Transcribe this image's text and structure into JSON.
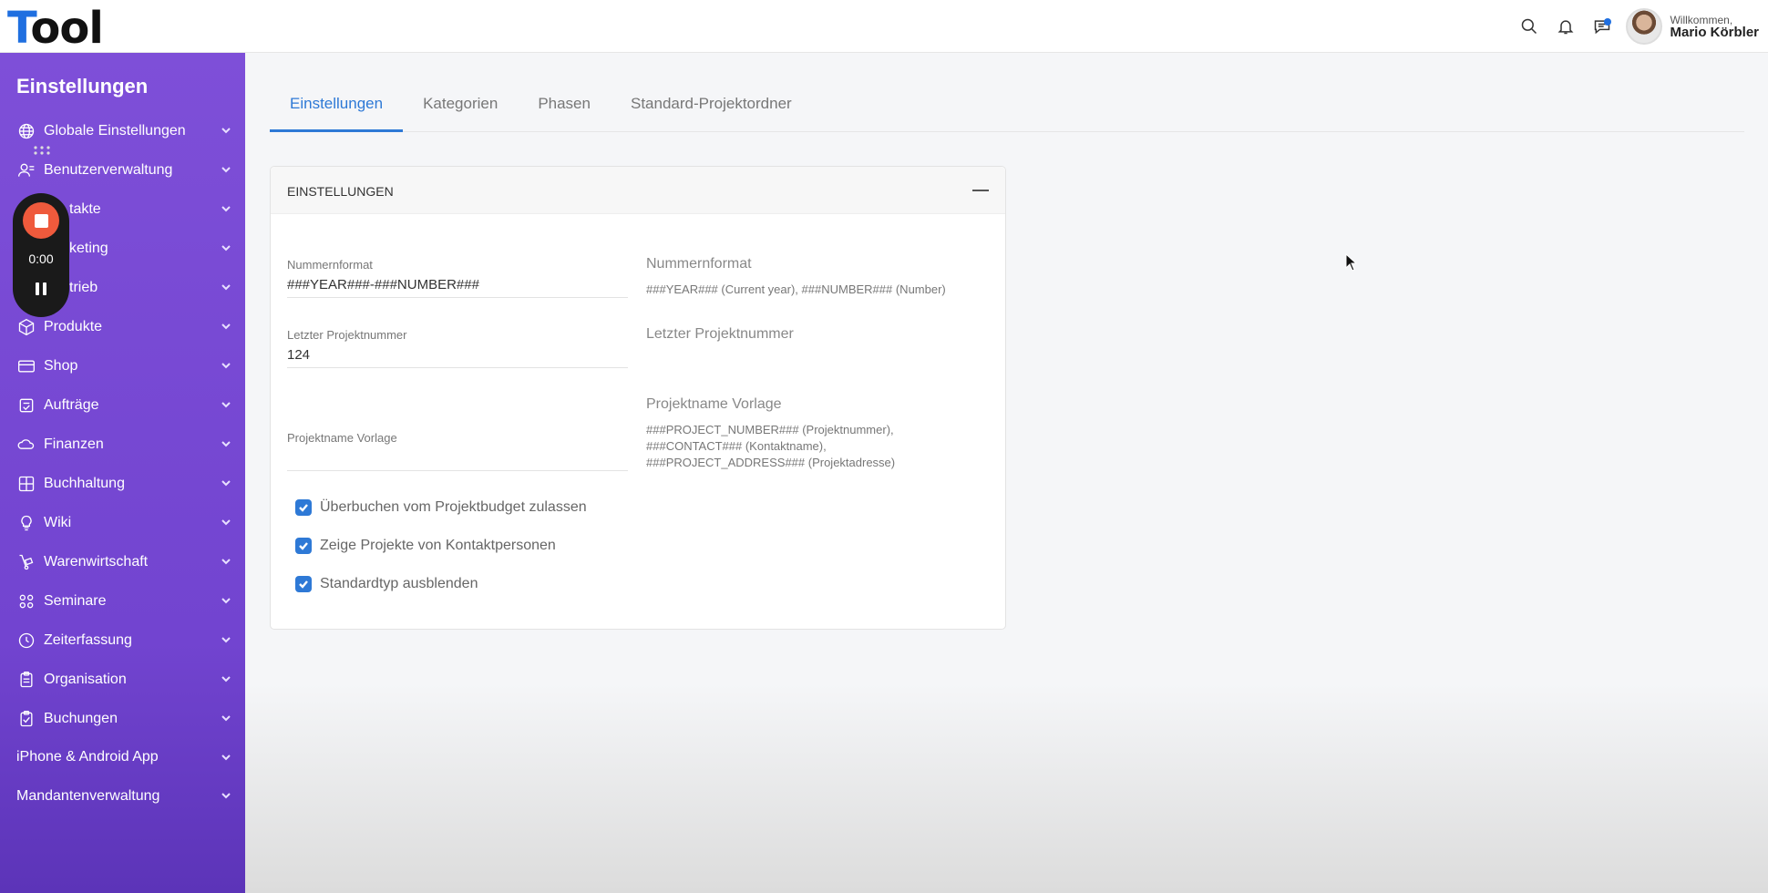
{
  "app": {
    "logo_first": "T",
    "logo_rest": "ool"
  },
  "user": {
    "welcome": "Willkommen,",
    "name": "Mario Körbler"
  },
  "sidebar": {
    "title": "Einstellungen",
    "items": [
      {
        "label": "Globale Einstellungen",
        "icon": "globe-icon"
      },
      {
        "label": "Benutzerverwaltung",
        "icon": "users-icon"
      },
      {
        "label": "takte",
        "icon": "contacts-icon"
      },
      {
        "label": "keting",
        "icon": "marketing-icon"
      },
      {
        "label": "trieb",
        "icon": "sales-icon"
      },
      {
        "label": "Produkte",
        "icon": "box-icon"
      },
      {
        "label": "Shop",
        "icon": "card-icon"
      },
      {
        "label": "Aufträge",
        "icon": "orders-icon"
      },
      {
        "label": "Finanzen",
        "icon": "cloud-coins-icon"
      },
      {
        "label": "Buchhaltung",
        "icon": "calculator-icon"
      },
      {
        "label": "Wiki",
        "icon": "lightbulb-icon"
      },
      {
        "label": "Warenwirtschaft",
        "icon": "dolly-icon"
      },
      {
        "label": "Seminare",
        "icon": "seminar-icon"
      },
      {
        "label": "Zeiterfassung",
        "icon": "clock-icon"
      },
      {
        "label": "Organisation",
        "icon": "clipboard-icon"
      },
      {
        "label": "Buchungen",
        "icon": "clipboard-check-icon"
      },
      {
        "label": "iPhone & Android App",
        "icon": ""
      },
      {
        "label": "Mandantenverwaltung",
        "icon": ""
      }
    ]
  },
  "recorder": {
    "time": "0:00"
  },
  "tabs": [
    {
      "label": "Einstellungen",
      "active": true
    },
    {
      "label": "Kategorien",
      "active": false
    },
    {
      "label": "Phasen",
      "active": false
    },
    {
      "label": "Standard-Projektordner",
      "active": false
    }
  ],
  "card": {
    "title": "EINSTELLUNGEN",
    "fields": {
      "number_format": {
        "label": "Nummernformat",
        "value": "###YEAR###-###NUMBER###"
      },
      "last_number": {
        "label": "Letzter Projektnummer",
        "value": "124"
      },
      "name_template": {
        "label": "Projektname Vorlage",
        "value": ""
      }
    },
    "help": {
      "number_format": {
        "title": "Nummernformat",
        "text": "###YEAR### (Current year), ###NUMBER### (Number)"
      },
      "last_number": {
        "title": "Letzter Projektnummer"
      },
      "name_template": {
        "title": "Projektname Vorlage",
        "line1": "###PROJECT_NUMBER### (Projektnummer),",
        "line2": "###CONTACT### (Kontaktname),",
        "line3": "###PROJECT_ADDRESS### (Projektadresse)"
      }
    },
    "checkboxes": [
      {
        "label": "Überbuchen vom Projektbudget zulassen",
        "checked": true
      },
      {
        "label": "Zeige Projekte von Kontaktpersonen",
        "checked": true
      },
      {
        "label": "Standardtyp ausblenden",
        "checked": true
      }
    ]
  },
  "colors": {
    "sidebar": "#7e4fd8",
    "accent": "#2e79d6",
    "logo_accent": "#1f6fe0",
    "record": "#ef5a3c"
  }
}
